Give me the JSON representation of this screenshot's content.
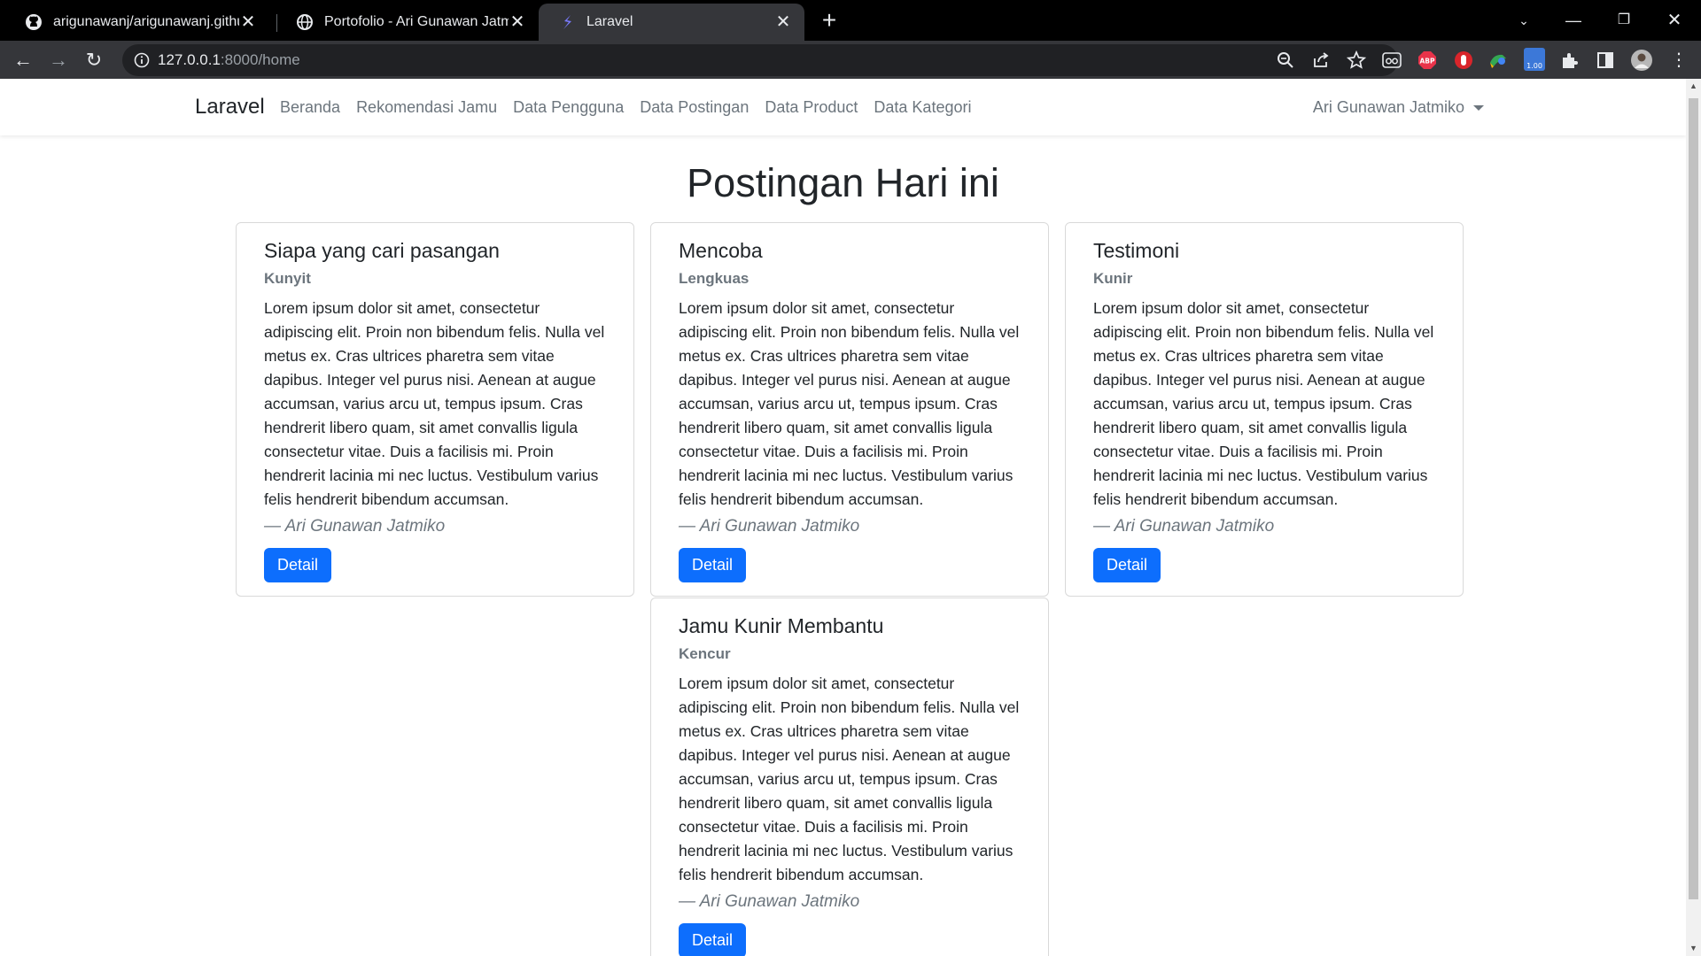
{
  "browser": {
    "tabs": [
      {
        "title": "arigunawanj/arigunawanj.github.io",
        "icon": "github-icon"
      },
      {
        "title": "Portofolio - Ari Gunawan Jatmiko",
        "icon": "globe-icon"
      },
      {
        "title": "Laravel",
        "icon": "laravel-icon"
      }
    ],
    "url_host": "127.0.0.1",
    "url_path": ":8000/home",
    "extension_badge": "1.00"
  },
  "navbar": {
    "brand": "Laravel",
    "links": [
      "Beranda",
      "Rekomendasi Jamu",
      "Data Pengguna",
      "Data Postingan",
      "Data Product",
      "Data Kategori"
    ],
    "user": "Ari Gunawan Jatmiko"
  },
  "main": {
    "heading": "Postingan Hari ini",
    "cards": [
      {
        "title": "Siapa yang cari pasangan",
        "subtitle": "Kunyit",
        "text": "Lorem ipsum dolor sit amet, consectetur adipiscing elit. Proin non bibendum felis. Nulla vel metus ex. Cras ultrices pharetra sem vitae dapibus. Integer vel purus nisi. Aenean at augue accumsan, varius arcu ut, tempus ipsum. Cras hendrerit libero quam, sit amet convallis ligula consectetur vitae. Duis a facilisis mi. Proin hendrerit lacinia mi nec luctus. Vestibulum varius felis hendrerit bibendum accumsan.",
        "author": "— Ari Gunawan Jatmiko",
        "button": "Detail"
      },
      {
        "title": "Mencoba",
        "subtitle": "Lengkuas",
        "text": "Lorem ipsum dolor sit amet, consectetur adipiscing elit. Proin non bibendum felis. Nulla vel metus ex. Cras ultrices pharetra sem vitae dapibus. Integer vel purus nisi. Aenean at augue accumsan, varius arcu ut, tempus ipsum. Cras hendrerit libero quam, sit amet convallis ligula consectetur vitae. Duis a facilisis mi. Proin hendrerit lacinia mi nec luctus. Vestibulum varius felis hendrerit bibendum accumsan.",
        "author": "— Ari Gunawan Jatmiko",
        "button": "Detail"
      },
      {
        "title": "Testimoni",
        "subtitle": "Kunir",
        "text": "Lorem ipsum dolor sit amet, consectetur adipiscing elit. Proin non bibendum felis. Nulla vel metus ex. Cras ultrices pharetra sem vitae dapibus. Integer vel purus nisi. Aenean at augue accumsan, varius arcu ut, tempus ipsum. Cras hendrerit libero quam, sit amet convallis ligula consectetur vitae. Duis a facilisis mi. Proin hendrerit lacinia mi nec luctus. Vestibulum varius felis hendrerit bibendum accumsan.",
        "author": "— Ari Gunawan Jatmiko",
        "button": "Detail"
      },
      {
        "title": "Jamu Kunir Membantu",
        "subtitle": "Kencur",
        "text": "Lorem ipsum dolor sit amet, consectetur adipiscing elit. Proin non bibendum felis. Nulla vel metus ex. Cras ultrices pharetra sem vitae dapibus. Integer vel purus nisi. Aenean at augue accumsan, varius arcu ut, tempus ipsum. Cras hendrerit libero quam, sit amet convallis ligula consectetur vitae. Duis a facilisis mi. Proin hendrerit lacinia mi nec luctus. Vestibulum varius felis hendrerit bibendum accumsan.",
        "author": "— Ari Gunawan Jatmiko",
        "button": "Detail"
      }
    ]
  },
  "colors": {
    "primary": "#0d6efd",
    "muted": "#6c757d",
    "text": "#212529",
    "chrome_dark": "#35363a"
  }
}
